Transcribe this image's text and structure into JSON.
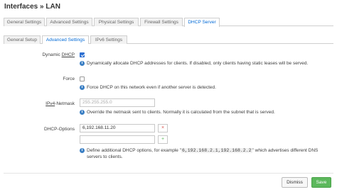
{
  "page": {
    "title": "Interfaces » LAN"
  },
  "main_tabs": [
    {
      "label": "General Settings"
    },
    {
      "label": "Advanced Settings"
    },
    {
      "label": "Physical Settings"
    },
    {
      "label": "Firewall Settings"
    },
    {
      "label": "DHCP Server"
    }
  ],
  "sub_tabs": [
    {
      "label": "General Setup"
    },
    {
      "label": "Advanced Settings"
    },
    {
      "label": "IPv6 Settings"
    }
  ],
  "fields": {
    "dynamic_dhcp": {
      "label_pre": "Dynamic ",
      "label_ul": "DHCP",
      "checked": true,
      "description": "Dynamically allocate DHCP addresses for clients. If disabled, only clients having static leases will be served."
    },
    "force": {
      "label": "Force",
      "checked": false,
      "description": "Force DHCP on this network even if another server is detected."
    },
    "netmask": {
      "label_ul": "IPv4",
      "label_post": "-Netmask",
      "placeholder": "255.255.255.0",
      "description": "Override the netmask sent to clients. Normally it is calculated from the subnet that is served."
    },
    "dhcp_options": {
      "label": "DHCP-Options",
      "value1": "6,192.168.11.20",
      "value2": "",
      "remove_icon": "×",
      "add_icon": "+",
      "desc_pre": "Define additional DHCP options, for example \"",
      "desc_code": "6,192.168.2.1,192.168.2.2",
      "desc_post": "\" which advertises different DNS",
      "desc_line2": "servers to clients."
    }
  },
  "info_icon_glyph": "i",
  "buttons": {
    "dismiss": "Dismiss",
    "save": "Save"
  },
  "colors": {
    "accent": "#0069d6",
    "save": "#5cb85c",
    "remove": "#d9534f",
    "info": "#3b7fc4"
  }
}
